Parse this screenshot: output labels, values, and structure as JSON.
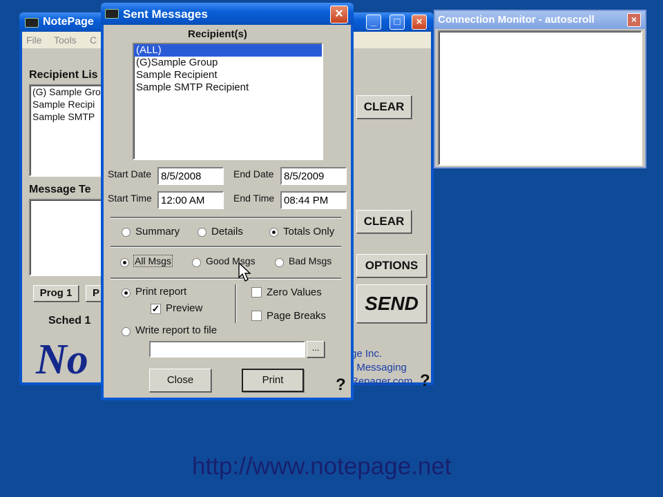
{
  "notepage": {
    "title": "NotePage",
    "menu": [
      "File",
      "Tools",
      "C"
    ],
    "recipient_list_label": "Recipient Lis",
    "recipients": [
      "(G) Sample Gro",
      "Sample Recipi",
      "Sample SMTP"
    ],
    "message_text_label": "Message Te",
    "clear1": "CLEAR",
    "clear2": "CLEAR",
    "options": "OPTIONS",
    "send": "SEND",
    "prog1": "Prog 1",
    "prog2": "P",
    "sched": "Sched 1",
    "logo": "No",
    "company": "ge Inc.",
    "tagline": "t Messaging",
    "website": "Repager.com",
    "help": "?"
  },
  "connection_monitor": {
    "title": "Connection Monitor - autoscroll",
    "close": "×"
  },
  "sent_messages": {
    "title": "Sent Messages",
    "close": "×",
    "recipients_label": "Recipient(s)",
    "recipients": [
      "(ALL)",
      "(G)Sample Group",
      "Sample Recipient",
      "Sample SMTP Recipient"
    ],
    "start_date_label": "Start Date",
    "start_date": "8/5/2008",
    "end_date_label": "End Date",
    "end_date": "8/5/2009",
    "start_time_label": "Start Time",
    "start_time": "12:00 AM",
    "end_time_label": "End Time",
    "end_time": "08:44 PM",
    "report_types": [
      "Summary",
      "Details",
      "Totals Only"
    ],
    "msg_filters": [
      "All Msgs",
      "Good Msgs",
      "Bad Msgs"
    ],
    "print_report": "Print report",
    "preview": "Preview",
    "zero_values": "Zero Values",
    "page_breaks": "Page Breaks",
    "write_report": "Write report to file",
    "file_path": "",
    "browse": "...",
    "close_button": "Close",
    "print_button": "Print",
    "help": "?"
  },
  "footer_url": "http://www.notepage.net",
  "colors": {
    "desktop": "#0f4a99",
    "titlebar": "#0754c6",
    "selection": "#2a5bd7"
  }
}
